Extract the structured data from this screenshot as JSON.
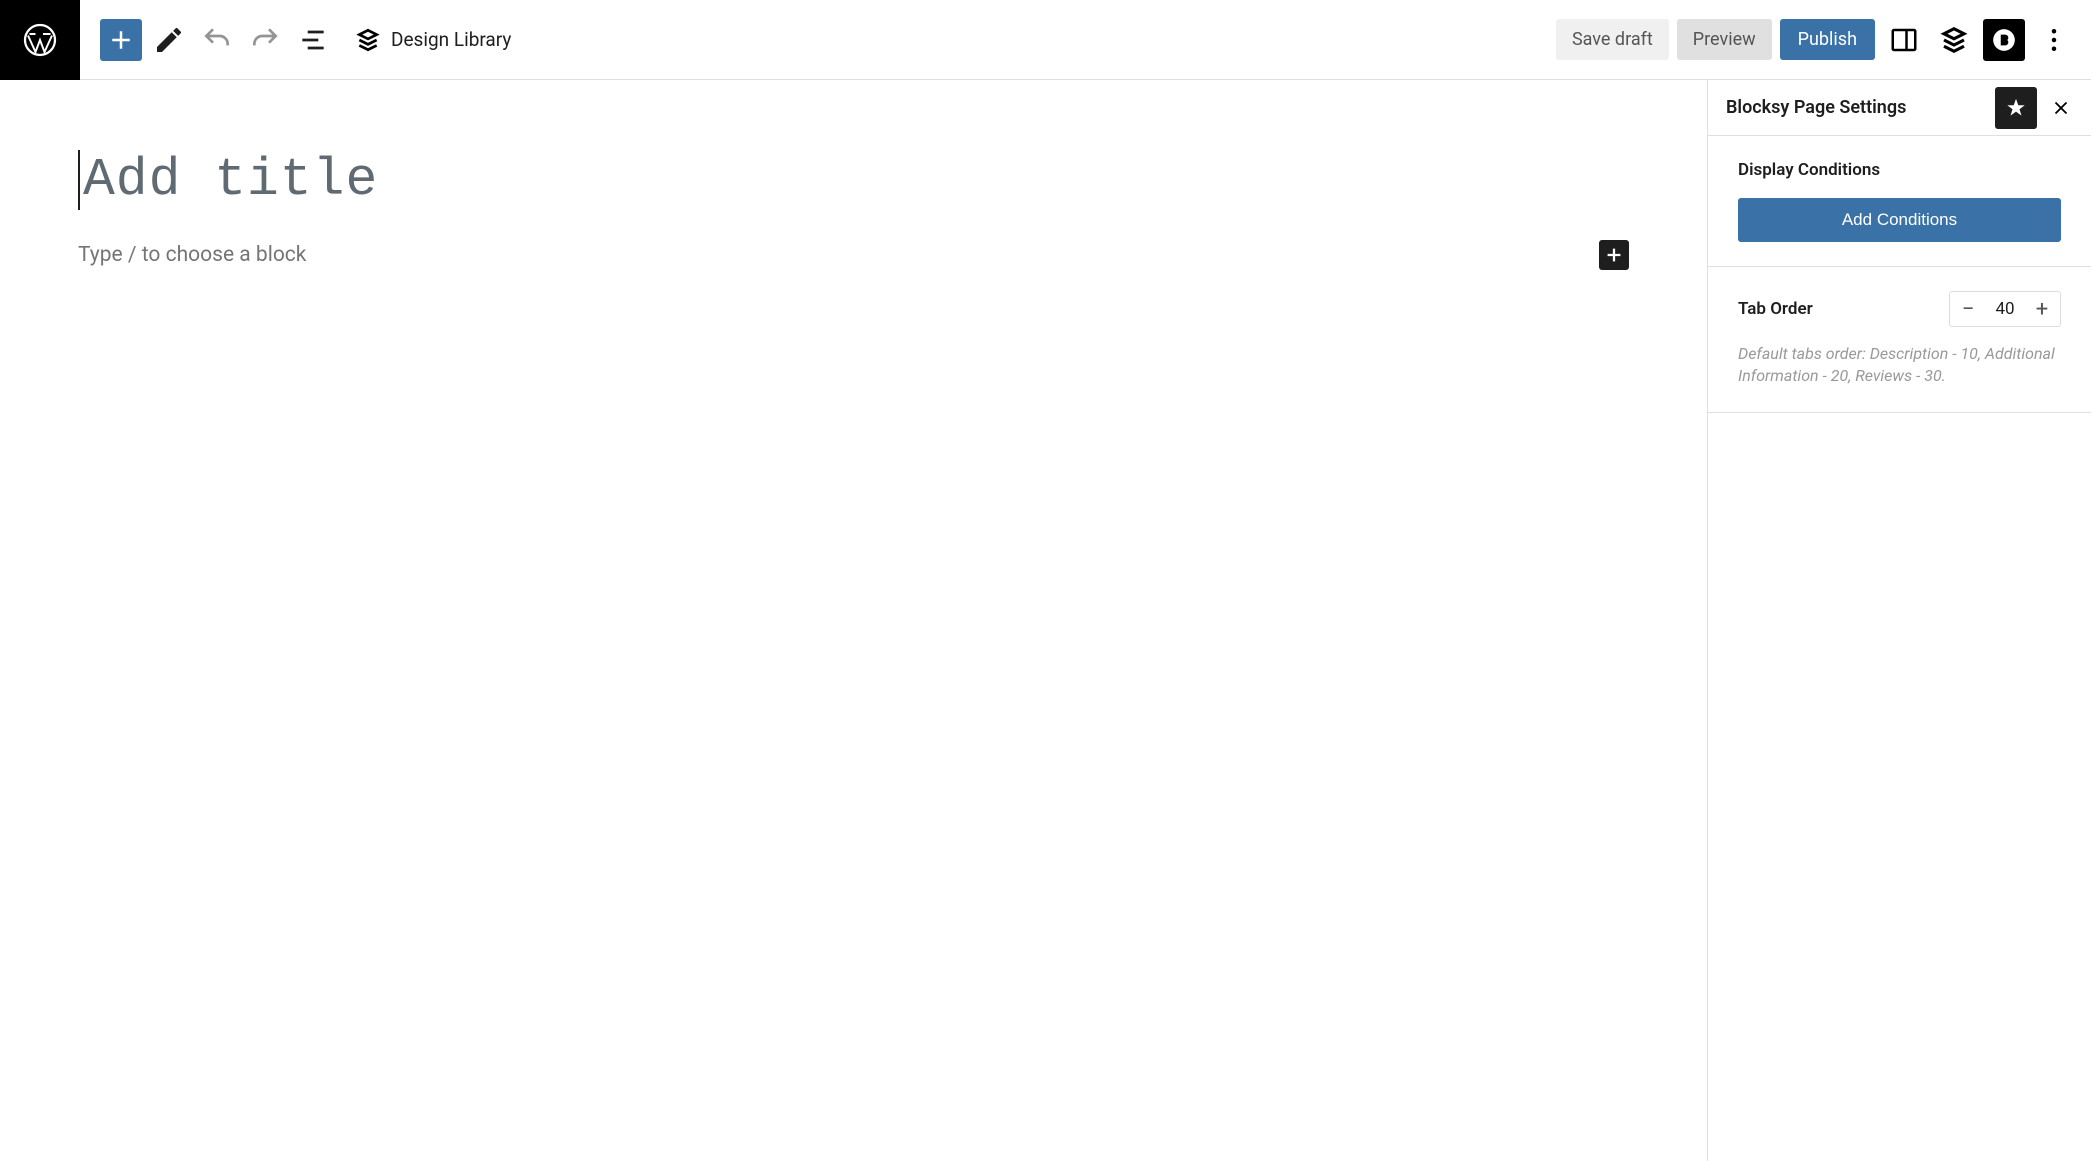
{
  "toolbar": {
    "design_library": "Design Library",
    "save_draft": "Save draft",
    "preview": "Preview",
    "publish": "Publish"
  },
  "editor": {
    "title_placeholder": "Add title",
    "content_placeholder": "Type / to choose a block"
  },
  "sidebar": {
    "title": "Blocksy Page Settings",
    "display_conditions": {
      "label": "Display Conditions",
      "button": "Add Conditions"
    },
    "tab_order": {
      "label": "Tab Order",
      "value": "40",
      "help": "Default tabs order: Description - 10, Additional Information - 20, Reviews - 30."
    }
  }
}
